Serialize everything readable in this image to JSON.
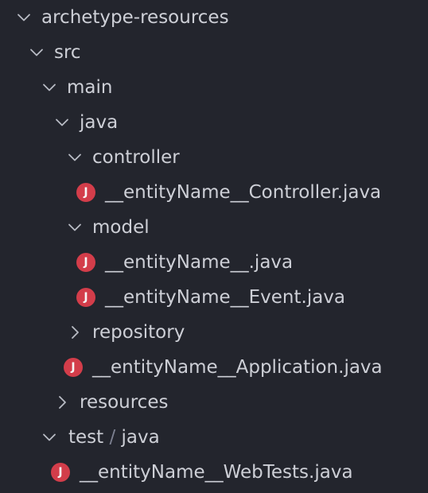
{
  "explorer": {
    "root_label": "archetype-resources",
    "src_label": "src",
    "main_label": "main",
    "java_label": "java",
    "controller_label": "controller",
    "controller_file": "__entityName__Controller.java",
    "model_label": "model",
    "model_file": "__entityName__.java",
    "event_file": "__entityName__Event.java",
    "repository_label": "repository",
    "application_file": "__entityName__Application.java",
    "resources_label": "resources",
    "test_label": "test",
    "test_sep": "/",
    "test_java_label": "java",
    "webtests_file": "__entityName__WebTests.java",
    "java_icon_letter": "J"
  },
  "colors": {
    "background": "#23252d",
    "text": "#cdcfd6",
    "java_icon": "#d33d4a",
    "chevron": "#b8bbc4"
  },
  "icons": {
    "expanded": "chevron-down-icon",
    "collapsed": "chevron-right-icon",
    "java_file": "java-file-icon"
  }
}
